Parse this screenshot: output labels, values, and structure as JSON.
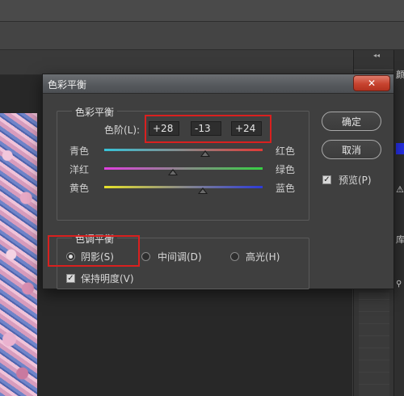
{
  "dialog": {
    "title": "色彩平衡",
    "close_glyph": "✕"
  },
  "color_balance": {
    "legend": "色彩平衡",
    "levels_label": "色阶(L):",
    "levels": [
      "+28",
      "-13",
      "+24"
    ],
    "sliders": [
      {
        "left": "青色",
        "right": "红色",
        "value": 28,
        "gradient": [
          "#37c3d8",
          "#e23a36"
        ]
      },
      {
        "left": "洋红",
        "right": "绿色",
        "value": -13,
        "gradient": [
          "#e13fe0",
          "#36d043"
        ]
      },
      {
        "left": "黄色",
        "right": "蓝色",
        "value": 24,
        "gradient": [
          "#e6e22a",
          "#2d3bd8"
        ]
      }
    ]
  },
  "tone_balance": {
    "legend": "色调平衡",
    "options": [
      "阴影(S)",
      "中间调(D)",
      "高光(H)"
    ],
    "selected": "阴影(S)",
    "preserve_luminosity": "保持明度(V)"
  },
  "buttons": {
    "ok": "确定",
    "cancel": "取消",
    "preview": "预览(P)"
  },
  "side_panel": {
    "collapse": "◂◂",
    "glyph_top": "颜",
    "glyph_library": "库",
    "warning_icon": "warning-icon",
    "search_icon": "search-icon"
  },
  "colors": {
    "highlight": "#d9201f",
    "swatch": "#2630e8"
  }
}
